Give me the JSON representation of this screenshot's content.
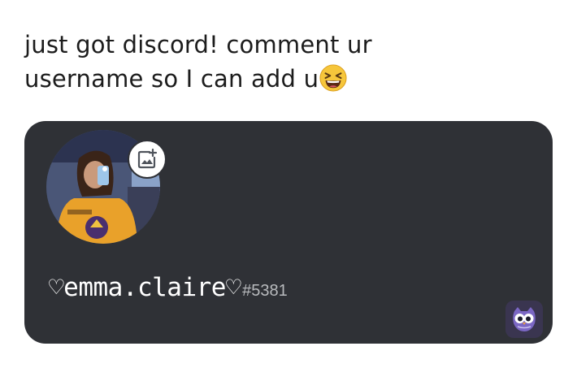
{
  "post": {
    "caption_line1": "just got discord! comment ur",
    "caption_line2": "username so I can add u",
    "caption_emoji": "grinning-squinting-face"
  },
  "profile_card": {
    "username": "♡emma.claire♡",
    "discriminator": "#5381",
    "avatar_icon": "profile-photo",
    "upload_icon": "add-image-icon",
    "background_color": "#2f3136"
  },
  "watermark": {
    "icon": "owl-logo"
  }
}
